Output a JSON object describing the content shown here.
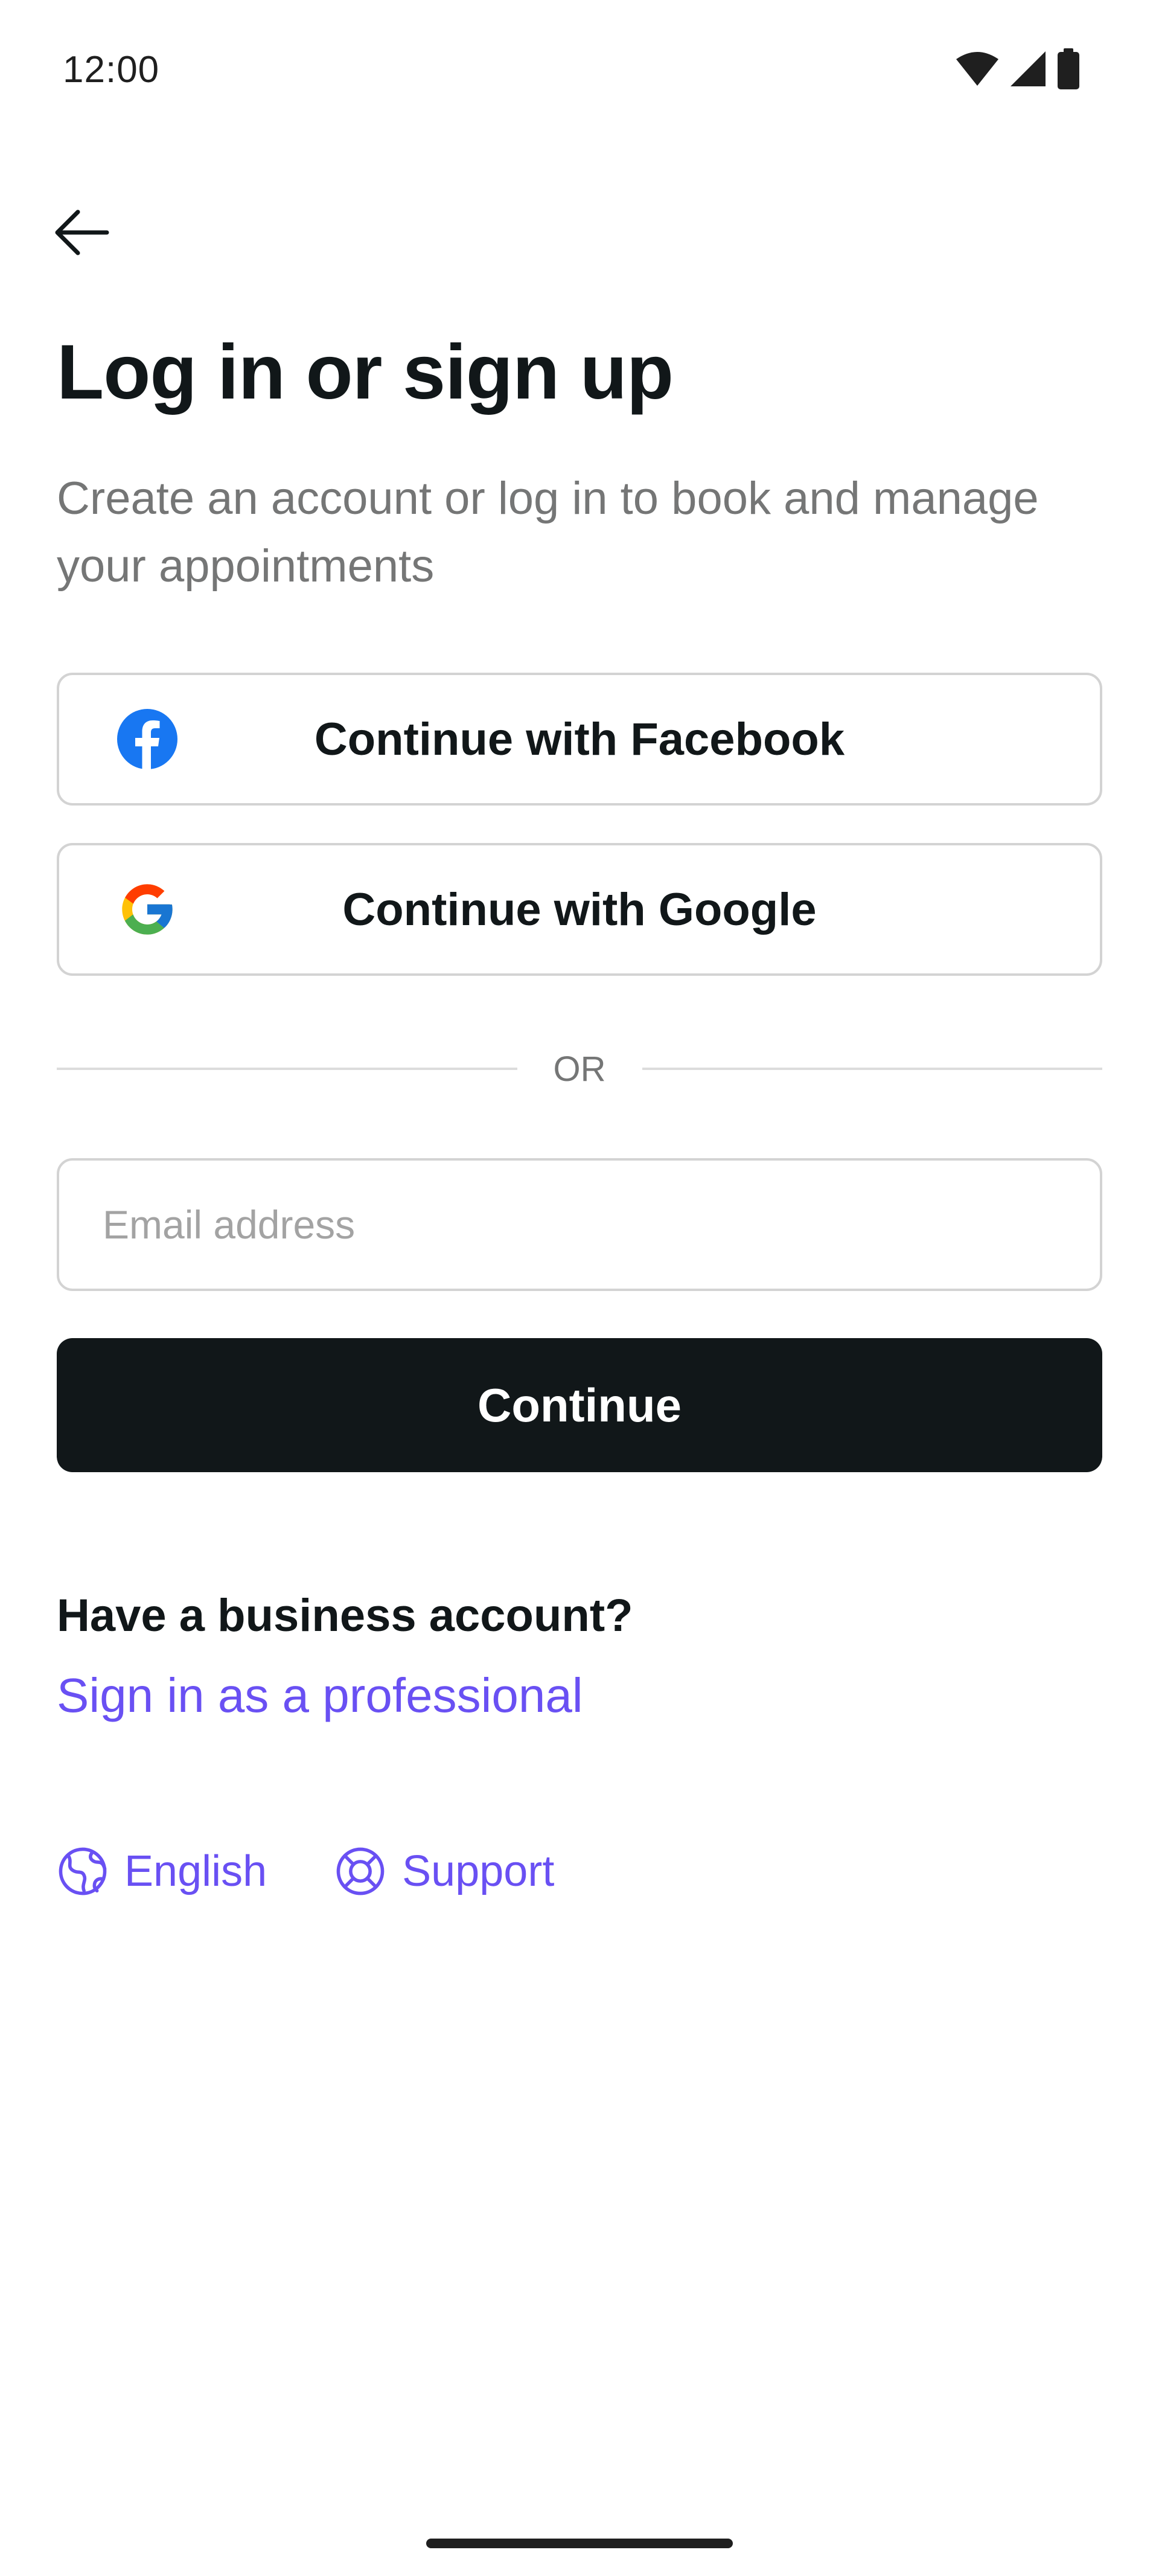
{
  "status_bar": {
    "time": "12:00"
  },
  "header": {
    "back_icon": "arrow-left-icon",
    "title": "Log in or sign up",
    "subtitle": "Create an account or log in to book and manage your appointments"
  },
  "social_login": {
    "facebook": {
      "label": "Continue with Facebook",
      "icon": "facebook-icon"
    },
    "google": {
      "label": "Continue with Google",
      "icon": "google-icon"
    }
  },
  "divider": {
    "text": "OR"
  },
  "email": {
    "placeholder": "Email address",
    "value": ""
  },
  "continue_label": "Continue",
  "business": {
    "heading": "Have a business account?",
    "link_label": "Sign in as a professional"
  },
  "footer": {
    "language": {
      "label": "English",
      "icon": "globe-icon"
    },
    "support": {
      "label": "Support",
      "icon": "lifebuoy-icon"
    }
  },
  "colors": {
    "accent": "#6950f3",
    "primary_button": "#111719",
    "facebook_blue": "#1877f2",
    "border": "#d3d3d3",
    "subtitle_text": "#757676"
  }
}
